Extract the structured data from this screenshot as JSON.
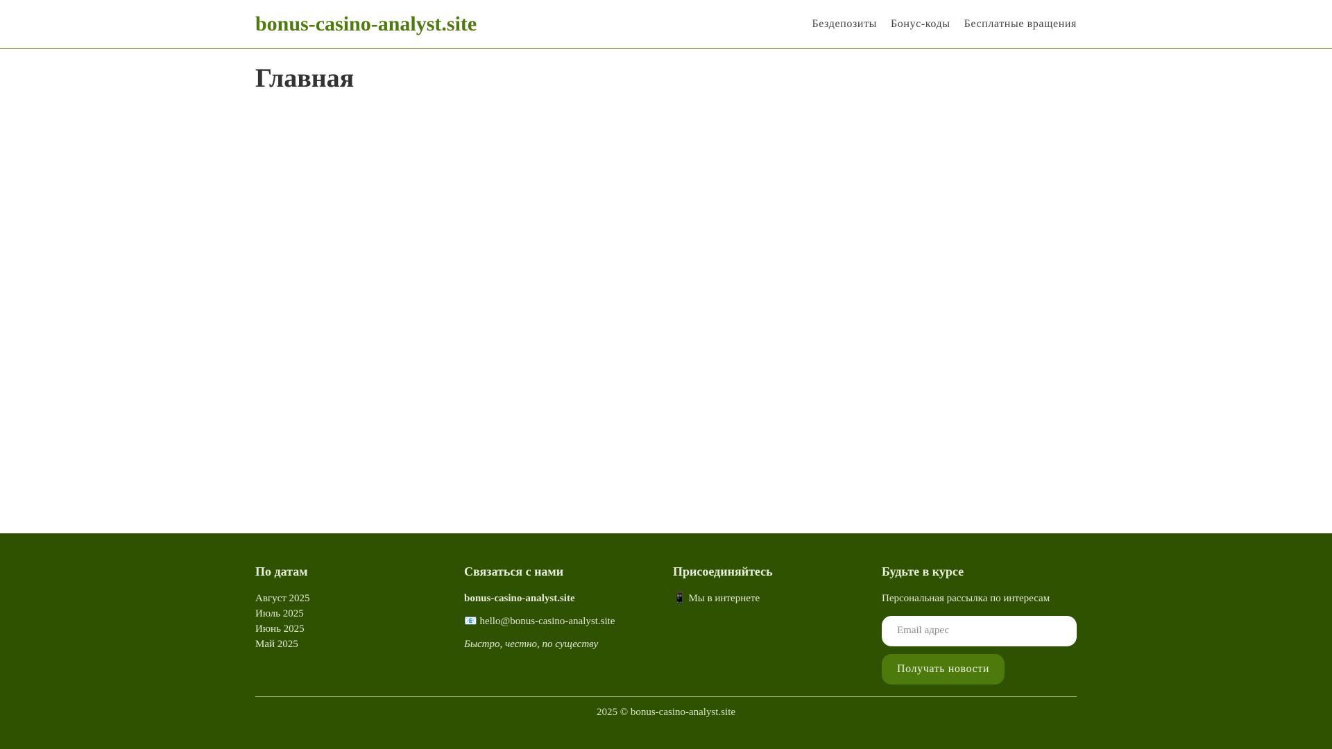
{
  "header": {
    "logo": "bonus-casino-analyst.site",
    "nav": [
      "Бездепозиты",
      "Бонус-коды",
      "Бесплатные вращения"
    ]
  },
  "main": {
    "title": "Главная"
  },
  "footer": {
    "archive": {
      "heading": "По датам",
      "items": [
        "Август 2025",
        "Июль 2025",
        "Июнь 2025",
        "Май 2025"
      ]
    },
    "contact": {
      "heading": "Связаться с нами",
      "brand": "bonus-casino-analyst.site",
      "email_icon": "📧",
      "email": "hello@bonus-casino-analyst.site",
      "slogan": "Быстро, честно, по существу"
    },
    "social": {
      "heading": "Присоединяйтесь",
      "icon": "📱",
      "link": "Мы в интернете"
    },
    "newsletter": {
      "heading": "Будьте в курсе",
      "text": "Персональная рассылка по интересам",
      "placeholder": "Email адрес",
      "button": "Получать новости"
    },
    "copyright": "2025 © bonus-casino-analyst.site"
  },
  "colors": {
    "brand": "#4f7a0e",
    "footer_bg": "#2e5200",
    "button_bg": "#4c7a0b"
  }
}
